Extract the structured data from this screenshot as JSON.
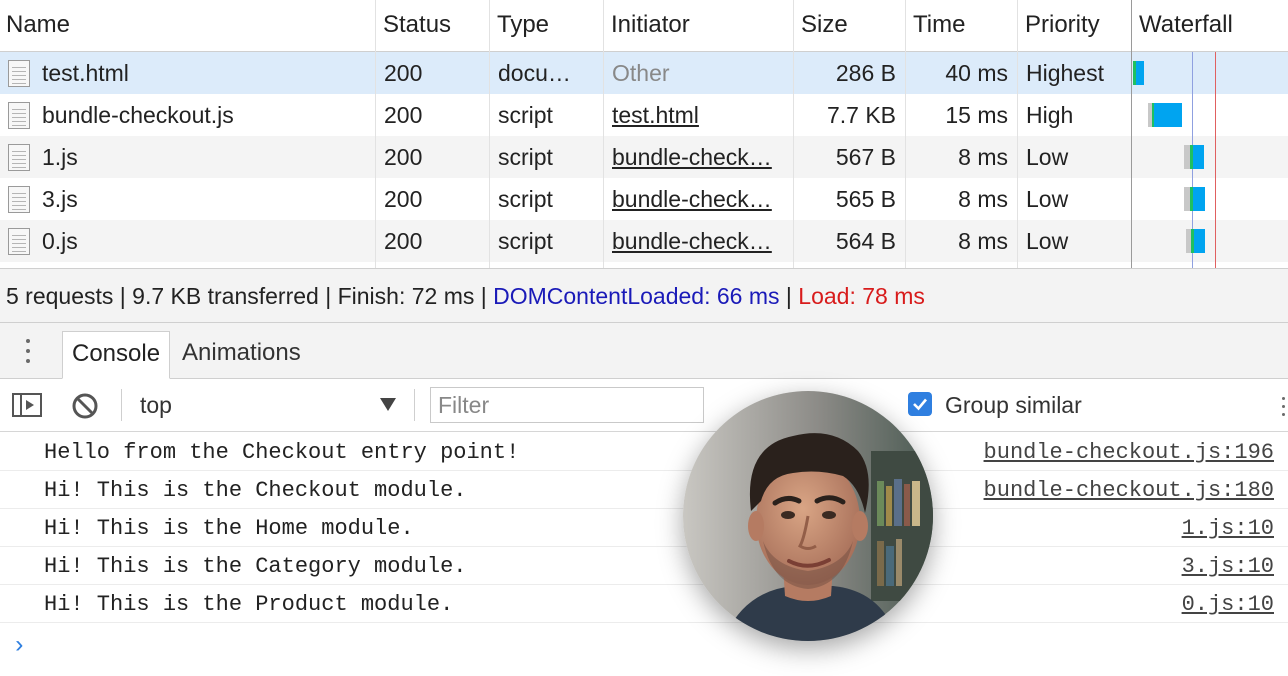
{
  "network": {
    "columns": {
      "name": "Name",
      "status": "Status",
      "type": "Type",
      "initiator": "Initiator",
      "size": "Size",
      "time": "Time",
      "priority": "Priority",
      "waterfall": "Waterfall"
    },
    "rows": [
      {
        "name": "test.html",
        "status": "200",
        "type": "docu…",
        "initiator": "Other",
        "size": "286 B",
        "time": "40 ms",
        "priority": "Highest"
      },
      {
        "name": "bundle-checkout.js",
        "status": "200",
        "type": "script",
        "initiator": "test.html",
        "size": "7.7 KB",
        "time": "15 ms",
        "priority": "High"
      },
      {
        "name": "1.js",
        "status": "200",
        "type": "script",
        "initiator": "bundle-check…",
        "size": "567 B",
        "time": "8 ms",
        "priority": "Low"
      },
      {
        "name": "3.js",
        "status": "200",
        "type": "script",
        "initiator": "bundle-check…",
        "size": "565 B",
        "time": "8 ms",
        "priority": "Low"
      },
      {
        "name": "0.js",
        "status": "200",
        "type": "script",
        "initiator": "bundle-check…",
        "size": "564 B",
        "time": "8 ms",
        "priority": "Low"
      }
    ]
  },
  "summary": {
    "requests": "5 requests",
    "transferred": "9.7 KB transferred",
    "finish": "Finish: 72 ms",
    "dom_content_loaded": "DOMContentLoaded: 66 ms",
    "load": "Load: 78 ms",
    "sep": " | "
  },
  "drawer": {
    "tabs": [
      "Console",
      "Animations"
    ]
  },
  "toolbar": {
    "context": "top",
    "filter_placeholder": "Filter",
    "group_similar_label": "Group similar",
    "group_similar_checked": true
  },
  "console": {
    "messages": [
      {
        "text": "Hello from the Checkout entry point!",
        "source": "bundle-checkout.js:196"
      },
      {
        "text": "Hi! This is the Checkout module.",
        "source": "bundle-checkout.js:180"
      },
      {
        "text": "Hi! This is the Home module.",
        "source": "1.js:10"
      },
      {
        "text": "Hi! This is the Category module.",
        "source": "3.js:10"
      },
      {
        "text": "Hi! This is the Product module.",
        "source": "0.js:10"
      }
    ],
    "prompt_symbol": "›"
  },
  "colors": {
    "dom_line": "#3a5ad0",
    "load_line": "#d81b1b",
    "waterfall_bar": "#00a4f0",
    "waterfall_wait": "#20c060",
    "accent": "#2f7fe0"
  },
  "icons": [
    "document-icon",
    "kebab-menu-icon",
    "sidebar-toggle-icon",
    "clear-console-icon",
    "dropdown-caret-icon",
    "checkbox-checked-icon",
    "more-options-icon",
    "console-prompt-icon"
  ]
}
